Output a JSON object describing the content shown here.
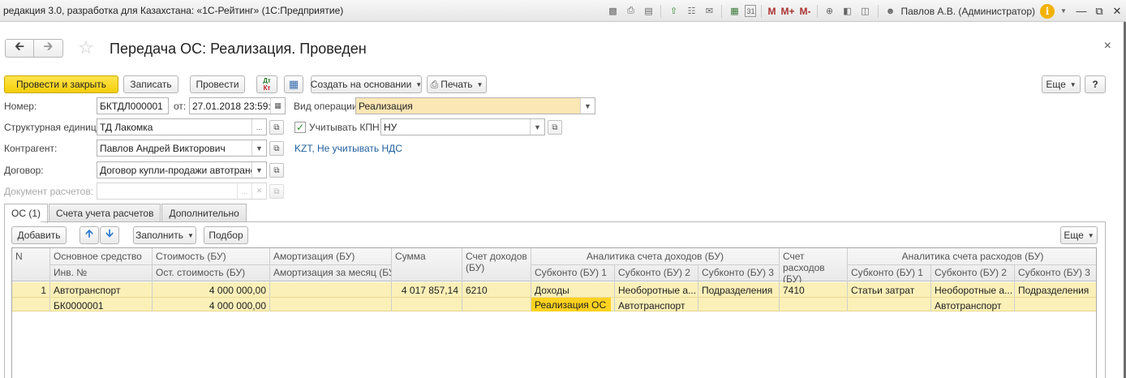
{
  "window": {
    "title": "редакция 3.0, разработка для Казахстана: «1С-Рейтинг»  (1С:Предприятие)",
    "user": "Павлов А.В. (Администратор)",
    "m_labels": [
      "M",
      "M+",
      "M-"
    ],
    "calendar_day": "31"
  },
  "header": {
    "title": "Передача ОС: Реализация. Проведен",
    "close": "×"
  },
  "toolbar": {
    "post_close": "Провести и закрыть",
    "save": "Записать",
    "post": "Провести",
    "dtkt_top": "Дт",
    "dtkt_bottom": "Кт",
    "create_based": "Создать на основании",
    "print": "Печать",
    "more": "Еще",
    "help": "?"
  },
  "form": {
    "number_label": "Номер:",
    "number": "БКТДЛ000001",
    "date_label": "от:",
    "date": "27.01.2018 23:59:5",
    "op_label": "Вид операции:",
    "op_value": "Реализация",
    "unit_label": "Структурная единица:",
    "unit_value": "ТД Лакомка",
    "kpn_label": "Учитывать КПН",
    "kpn_value": "НУ",
    "counterparty_label": "Контрагент:",
    "counterparty_value": "Павлов Андрей Викторович",
    "vat_link": "KZT, Не учитывать НДС",
    "contract_label": "Договор:",
    "contract_value": "Договор купли-продажи автотрансп",
    "settlement_label": "Документ расчетов:",
    "settlement_value": ""
  },
  "tabs": [
    {
      "label": "ОС (1)",
      "active": true
    },
    {
      "label": "Счета учета расчетов",
      "active": false
    },
    {
      "label": "Дополнительно",
      "active": false
    }
  ],
  "table_toolbar": {
    "add": "Добавить",
    "fill": "Заполнить",
    "pick": "Подбор",
    "more": "Еще"
  },
  "table": {
    "headers": {
      "n": "N",
      "asset": "Основное средство",
      "inv": "Инв. №",
      "cost": "Стоимость (БУ)",
      "residual": "Ост. стоимость (БУ)",
      "amort": "Амортизация (БУ)",
      "amort_month": "Амортизация за месяц (БУ)",
      "sum": "Сумма",
      "income_account": "Счет доходов (БУ)",
      "income_analytics": "Аналитика счета доходов (БУ)",
      "inc_sub1": "Субконто (БУ) 1",
      "inc_sub2": "Субконто (БУ) 2",
      "inc_sub3": "Субконто (БУ) 3",
      "expense_account": "Счет расходов (БУ)",
      "expense_analytics": "Аналитика счета расходов (БУ)",
      "exp_sub1": "Субконто (БУ) 1",
      "exp_sub2": "Субконто (БУ) 2",
      "exp_sub3": "Субконто (БУ) 3"
    },
    "row": {
      "n": "1",
      "asset": "Автотранспорт",
      "inv": "БК0000001",
      "cost": "4 000 000,00",
      "residual": "4 000 000,00",
      "amort": "",
      "amort_month": "",
      "sum": "4 017 857,14",
      "income_account": "6210",
      "inc_sub1": "Доходы",
      "inc_sub1_b": "Реализация ОС",
      "inc_sub2": "Необоротные а...",
      "inc_sub2_b": "Автотранспорт",
      "inc_sub3": "Подразделения",
      "expense_account": "7410",
      "exp_sub1": "Статьи затрат",
      "exp_sub2": "Необоротные а...",
      "exp_sub2_b": "Автотранспорт",
      "exp_sub3": "Подразделения"
    }
  },
  "colors": {
    "primary_button": "#f5cf0a",
    "selected_row": "#fbf0b8",
    "selected_cell": "#ffd21f",
    "link": "#1f5f9e",
    "operation_field": "#fbe6b5"
  }
}
